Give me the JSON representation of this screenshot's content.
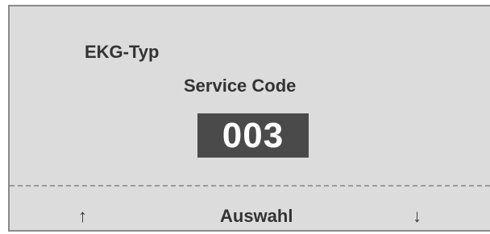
{
  "screen": {
    "title": "EKG-Typ",
    "subtitle": "Service Code",
    "code_value": "003"
  },
  "softkeys": {
    "up": "↑",
    "select": "Auswahl",
    "down": "↓"
  },
  "colors": {
    "screen_background": "#dcdcdc",
    "code_background": "#4a4a4a",
    "code_text": "#ffffff",
    "text": "#333333"
  }
}
